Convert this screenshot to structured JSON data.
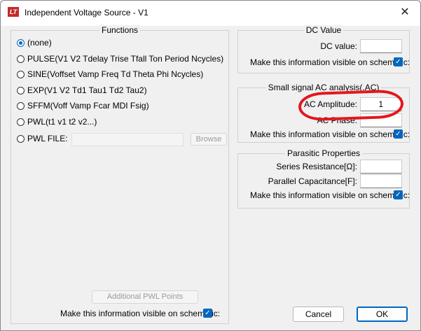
{
  "window": {
    "title": "Independent Voltage Source - V1",
    "app_icon_text": "LT",
    "close_glyph": "✕"
  },
  "functions": {
    "title": "Functions",
    "options": [
      {
        "label": "(none)",
        "selected": true
      },
      {
        "label": "PULSE(V1 V2 Tdelay Trise Tfall Ton Period Ncycles)",
        "selected": false
      },
      {
        "label": "SINE(Voffset Vamp Freq Td Theta Phi Ncycles)",
        "selected": false
      },
      {
        "label": "EXP(V1 V2 Td1 Tau1 Td2 Tau2)",
        "selected": false
      },
      {
        "label": "SFFM(Voff Vamp Fcar MDI Fsig)",
        "selected": false
      },
      {
        "label": "PWL(t1 v1 t2 v2...)",
        "selected": false
      },
      {
        "label": "PWL FILE:",
        "selected": false
      }
    ],
    "browse_label": "Browse",
    "pwl_file_value": "",
    "additional_pwl_label": "Additional PWL Points",
    "visible_label": "Make this information visible on schematic:",
    "visible_checked": true
  },
  "dc": {
    "title": "DC Value",
    "dc_value_label": "DC value:",
    "dc_value": "",
    "visible_label": "Make this information visible on schematic:"
  },
  "ac": {
    "title": "Small signal AC analysis(.AC)",
    "amplitude_label": "AC Amplitude:",
    "amplitude_value": "1",
    "phase_label": "AC Phase:",
    "phase_value": "",
    "visible_label": "Make this information visible on schematic:"
  },
  "parasitic": {
    "title": "Parasitic Properties",
    "series_label": "Series Resistance[Ω]:",
    "series_value": "",
    "parallel_label": "Parallel Capacitance[F]:",
    "parallel_value": "",
    "visible_label": "Make this information visible on schematic:"
  },
  "buttons": {
    "cancel": "Cancel",
    "ok": "OK"
  },
  "check_glyph": "✓",
  "colors": {
    "accent": "#0067c0",
    "annotation": "#e3171d"
  }
}
